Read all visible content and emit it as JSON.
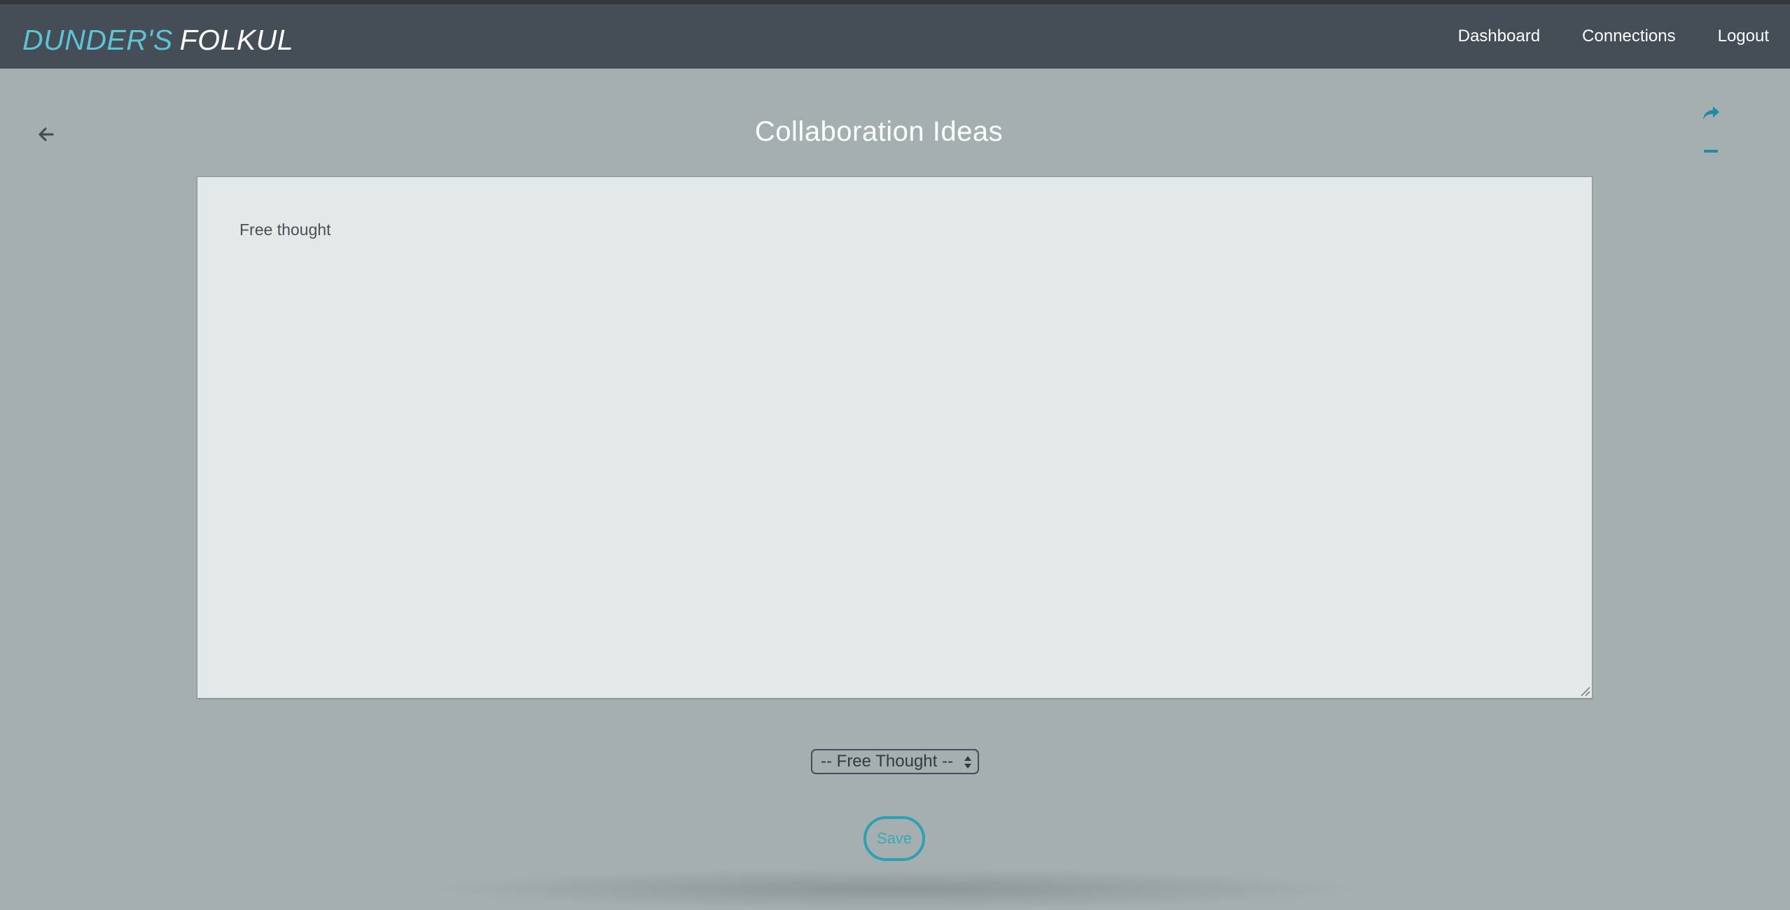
{
  "app": {
    "brand_part1": "DUNDER'S",
    "brand_part2": "FOLKUL"
  },
  "nav": {
    "items": [
      {
        "label": "Dashboard"
      },
      {
        "label": "Connections"
      },
      {
        "label": "Logout"
      }
    ]
  },
  "page": {
    "title": "Collaboration Ideas",
    "back_icon": "arrow-left-icon",
    "share_icon": "share-icon",
    "minimize_icon": "minus-icon"
  },
  "editor": {
    "content": "Free thought"
  },
  "type_select": {
    "selected": "-- Free Thought --"
  },
  "actions": {
    "save_label": "Save"
  },
  "colors": {
    "navbar": "#454d56",
    "background": "#a6afb0",
    "accent": "#2e9fb5",
    "brand_accent": "#5bc4d6",
    "editor_bg": "#e3e8e9"
  }
}
